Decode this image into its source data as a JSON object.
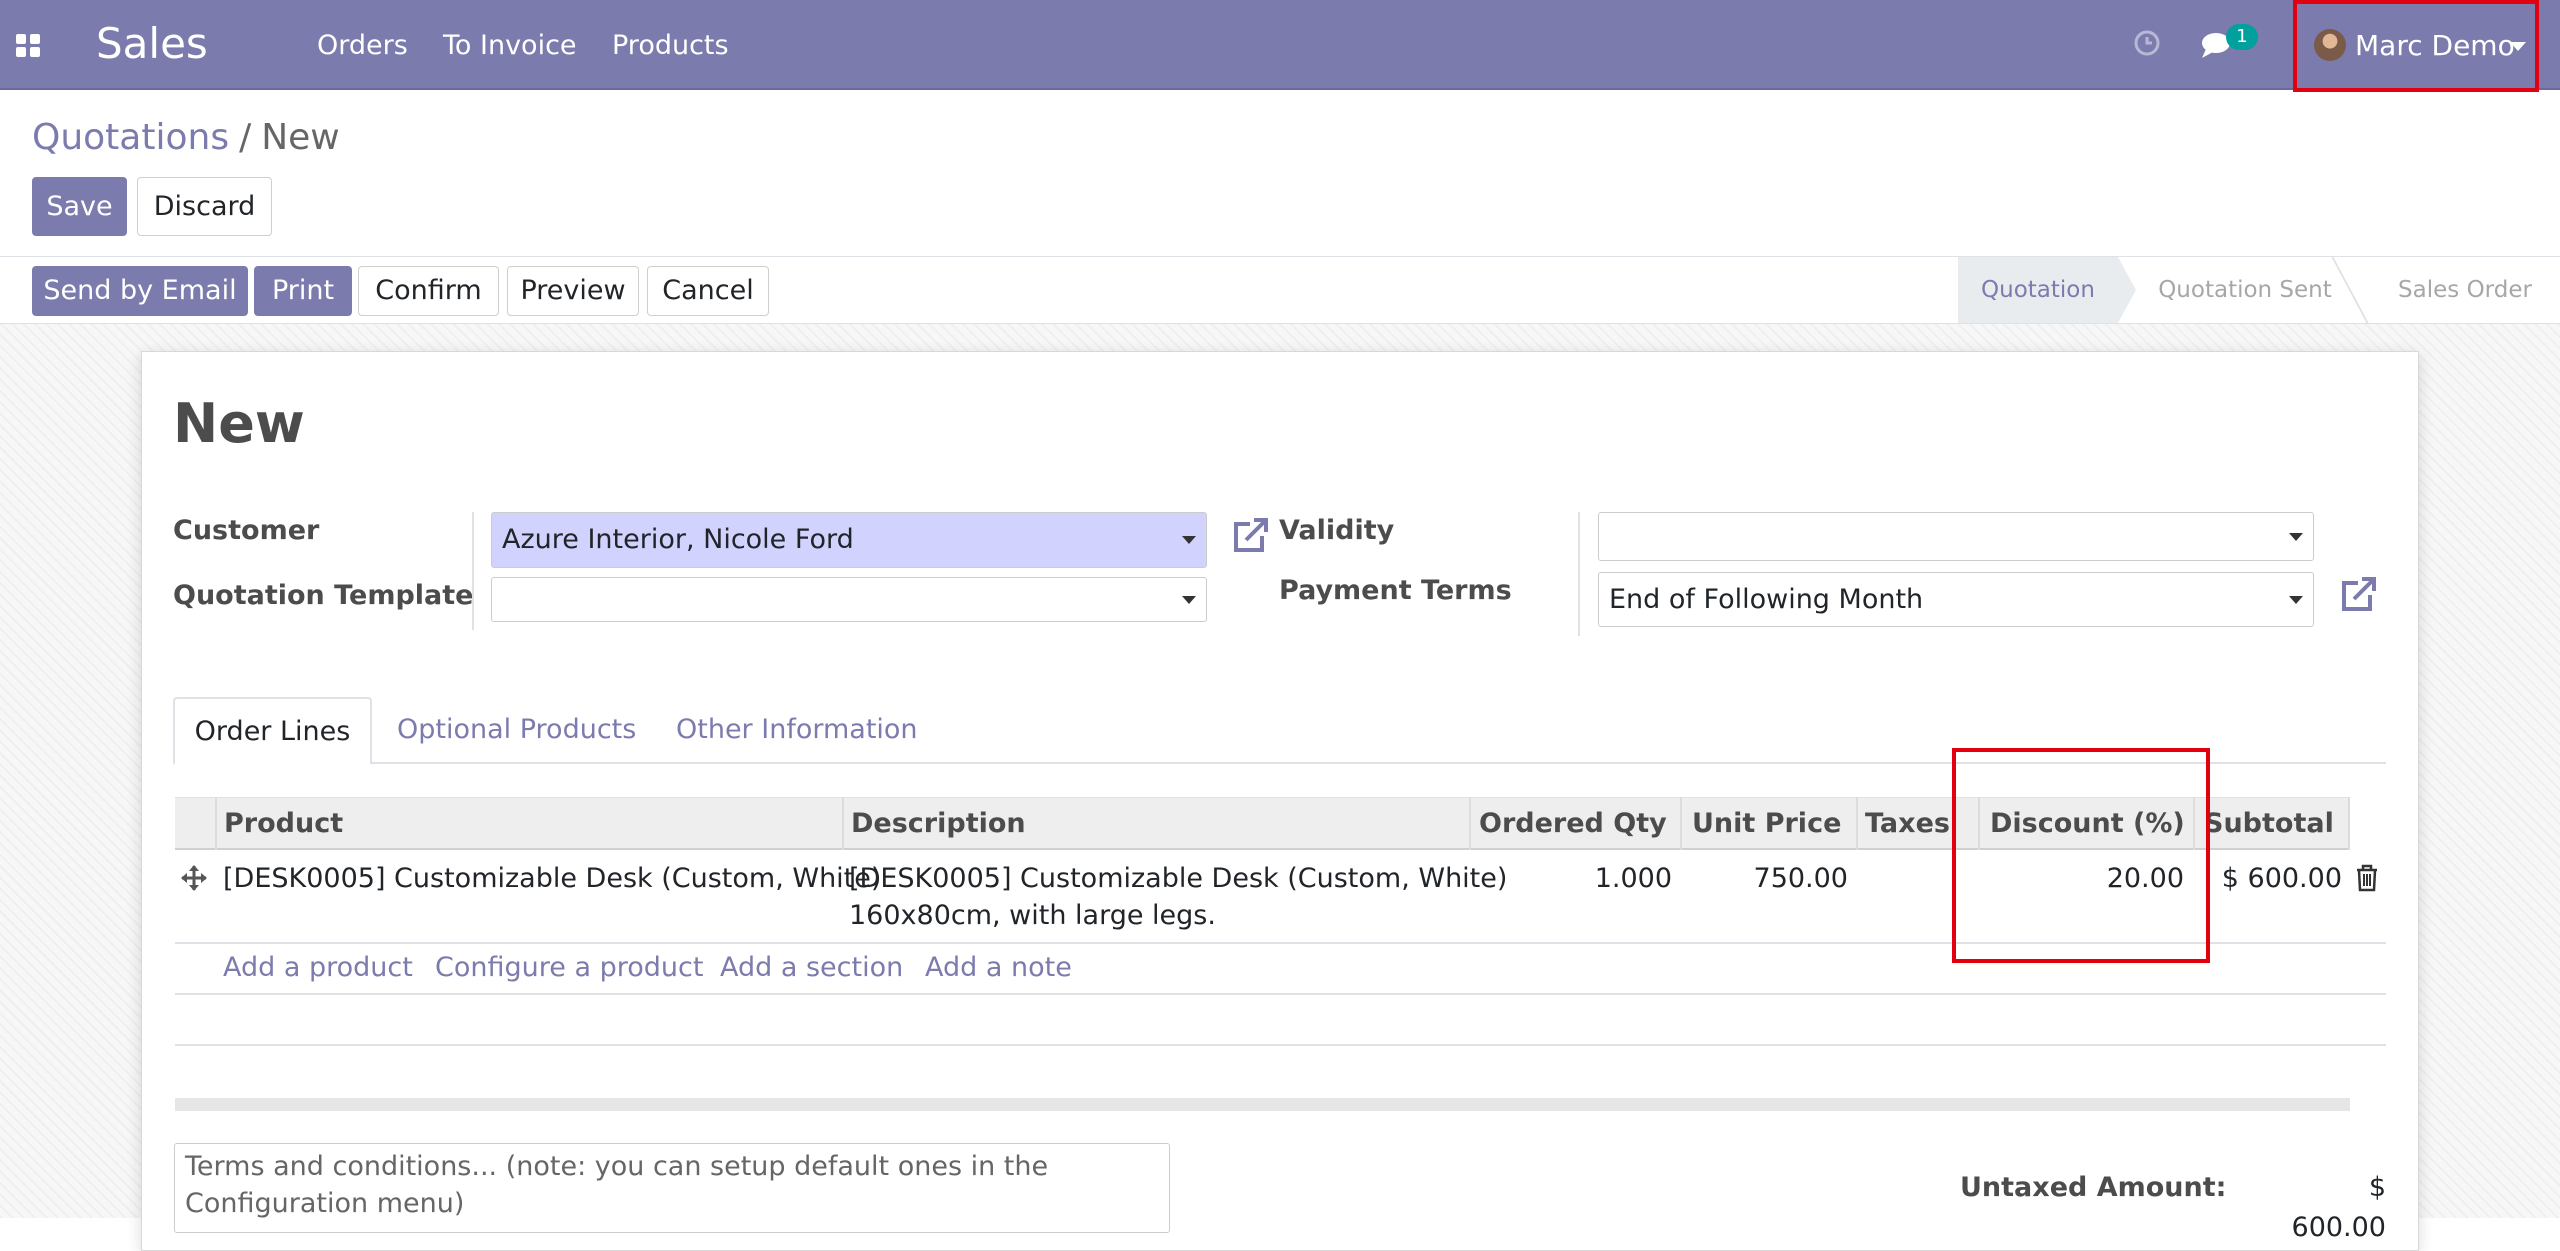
{
  "navbar": {
    "app_title": "Sales",
    "menus": [
      "Orders",
      "To Invoice",
      "Products"
    ],
    "message_count": "1",
    "user_name": "Marc Demo",
    "brand_color": "#7c7bad"
  },
  "breadcrumb": {
    "root": "Quotations",
    "separator": "/",
    "current": "New"
  },
  "control_buttons": {
    "save": "Save",
    "discard": "Discard"
  },
  "status_buttons": {
    "send_email": "Send by Email",
    "print": "Print",
    "confirm": "Confirm",
    "preview": "Preview",
    "cancel": "Cancel"
  },
  "stages": [
    "Quotation",
    "Quotation Sent",
    "Sales Order"
  ],
  "active_stage": "Quotation",
  "form": {
    "title": "New",
    "customer_label": "Customer",
    "customer_value": "Azure Interior, Nicole Ford",
    "template_label": "Quotation Template",
    "template_value": "",
    "validity_label": "Validity",
    "validity_value": "",
    "payment_terms_label": "Payment Terms",
    "payment_terms_value": "End of Following Month"
  },
  "tabs": [
    "Order Lines",
    "Optional Products",
    "Other Information"
  ],
  "order_lines": {
    "columns": [
      "Product",
      "Description",
      "Ordered Qty",
      "Unit Price",
      "Taxes",
      "Discount (%)",
      "Subtotal"
    ],
    "rows": [
      {
        "product": "[DESK0005] Customizable Desk (Custom, White)",
        "description_line1": "[DESK0005] Customizable Desk (Custom, White)",
        "description_line2": "160x80cm, with large legs.",
        "qty": "1.000",
        "unit_price": "750.00",
        "taxes": "",
        "discount": "20.00",
        "subtotal": "$ 600.00"
      }
    ],
    "add_links": [
      "Add a product",
      "Configure a product",
      "Add a section",
      "Add a note"
    ]
  },
  "footer": {
    "terms_placeholder_line1": "Terms and conditions... (note: you can setup default ones in the",
    "terms_placeholder_line2": "Configuration menu)",
    "untaxed_label": "Untaxed Amount:",
    "untaxed_value": "$ 600.00"
  },
  "highlight_color": "#e1000f"
}
